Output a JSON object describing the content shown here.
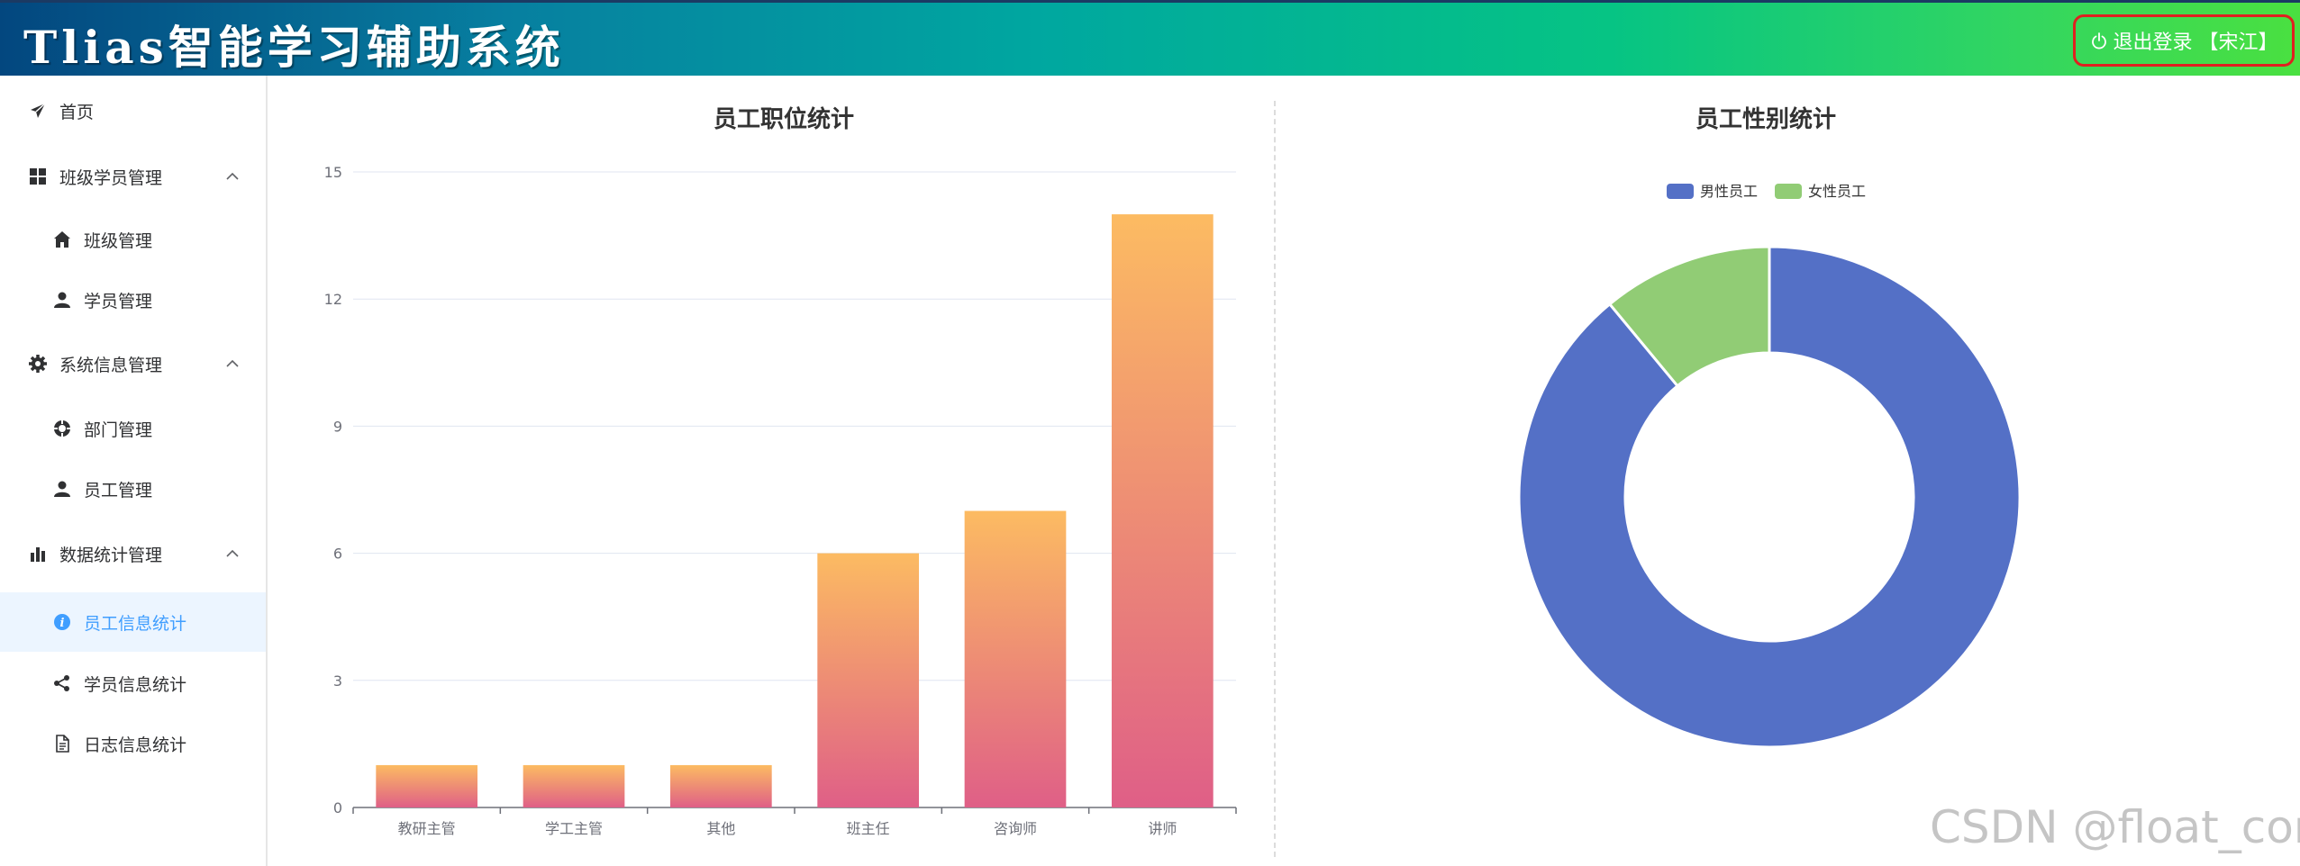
{
  "header": {
    "title": "Tlias智能学习辅助系统",
    "logout_label": "退出登录 【宋江】"
  },
  "sidebar": {
    "items": [
      {
        "label": "首页",
        "icon": "paper-plane-icon",
        "level": "top"
      },
      {
        "label": "班级学员管理",
        "icon": "grid-icon",
        "level": "top",
        "expanded": true
      },
      {
        "label": "班级管理",
        "icon": "home-icon",
        "level": "sub"
      },
      {
        "label": "学员管理",
        "icon": "user-icon",
        "level": "sub"
      },
      {
        "label": "系统信息管理",
        "icon": "gear-icon",
        "level": "top",
        "expanded": true
      },
      {
        "label": "部门管理",
        "icon": "help-circle-icon",
        "level": "sub"
      },
      {
        "label": "员工管理",
        "icon": "user-icon",
        "level": "sub"
      },
      {
        "label": "数据统计管理",
        "icon": "bar-chart-icon",
        "level": "top",
        "expanded": true
      },
      {
        "label": "员工信息统计",
        "icon": "info-icon",
        "level": "sub",
        "active": true
      },
      {
        "label": "学员信息统计",
        "icon": "share-icon",
        "level": "sub"
      },
      {
        "label": "日志信息统计",
        "icon": "document-icon",
        "level": "sub"
      }
    ]
  },
  "colors": {
    "active_text": "#409eff",
    "active_bg": "#ecf5ff",
    "bar_top": "#fcbb62",
    "bar_bottom": "#df5f87",
    "male": "#5470c6",
    "female": "#91cc75"
  },
  "chart_data": [
    {
      "type": "bar",
      "title": "员工职位统计",
      "categories": [
        "教研主管",
        "学工主管",
        "其他",
        "班主任",
        "咨询师",
        "讲师"
      ],
      "values": [
        1,
        1,
        1,
        6,
        7,
        14
      ],
      "ylim": [
        0,
        15
      ],
      "yticks": [
        0,
        3,
        6,
        9,
        12,
        15
      ],
      "grid": true
    },
    {
      "type": "pie",
      "variant": "donut",
      "title": "员工性别统计",
      "legend_position": "top",
      "slices": [
        {
          "name": "男性员工",
          "value": 89
        },
        {
          "name": "女性员工",
          "value": 11
        }
      ]
    }
  ],
  "watermark": "CSDN @float_com"
}
